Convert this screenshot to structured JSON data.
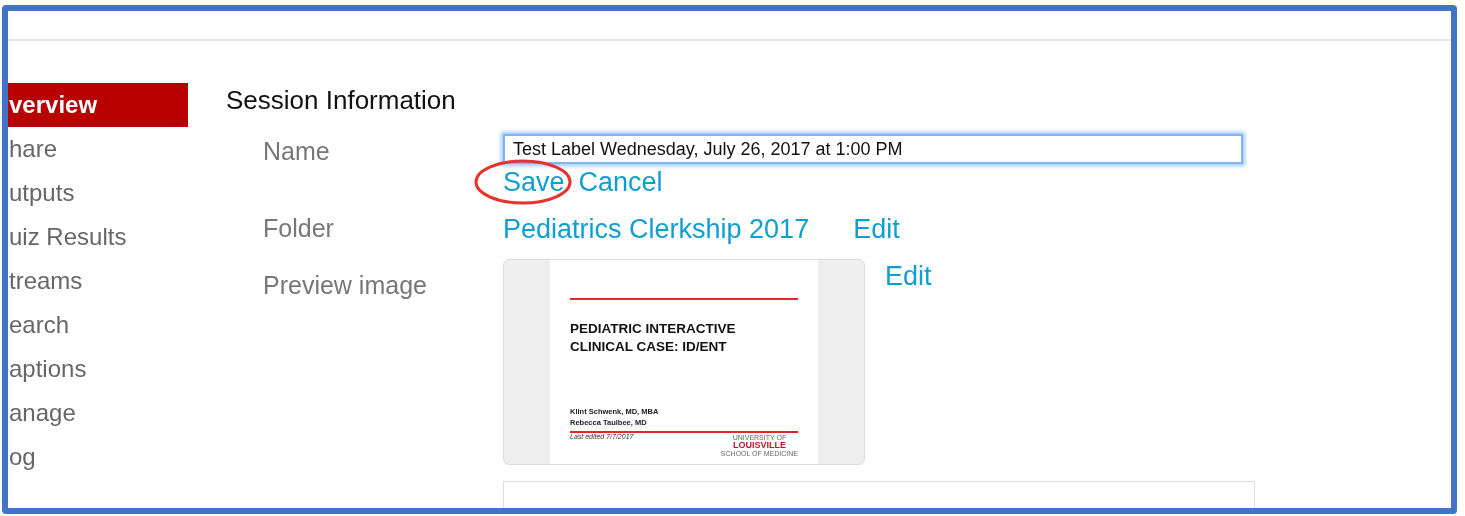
{
  "sidebar": {
    "items": [
      {
        "label": "verview",
        "selected": true
      },
      {
        "label": "hare",
        "selected": false
      },
      {
        "label": "utputs",
        "selected": false
      },
      {
        "label": "uiz Results",
        "selected": false
      },
      {
        "label": "treams",
        "selected": false
      },
      {
        "label": "earch",
        "selected": false
      },
      {
        "label": "aptions",
        "selected": false
      },
      {
        "label": "anage",
        "selected": false
      },
      {
        "label": "og",
        "selected": false
      }
    ]
  },
  "section_title": "Session Information",
  "name": {
    "label": "Name",
    "value": "Test Label Wednesday, July 26, 2017 at 1:00 PM",
    "save": "Save",
    "cancel": "Cancel",
    "save_circled": true
  },
  "folder": {
    "label": "Folder",
    "value": "Pediatrics Clerkship 2017",
    "edit": "Edit"
  },
  "preview": {
    "label": "Preview image",
    "edit": "Edit",
    "slide": {
      "title_lines": [
        "PEDIATRIC INTERACTIVE",
        "CLINICAL CASE: ID/ENT"
      ],
      "authors": [
        "Klint Schwenk, MD, MBA",
        "Rebecca Taulbee, MD"
      ],
      "footer_note": "Last edited 7/7/2017",
      "logo_top": "UNIVERSITY OF",
      "logo_name": "LOUISVILLE",
      "logo_bottom": "SCHOOL OF MEDICINE"
    }
  }
}
